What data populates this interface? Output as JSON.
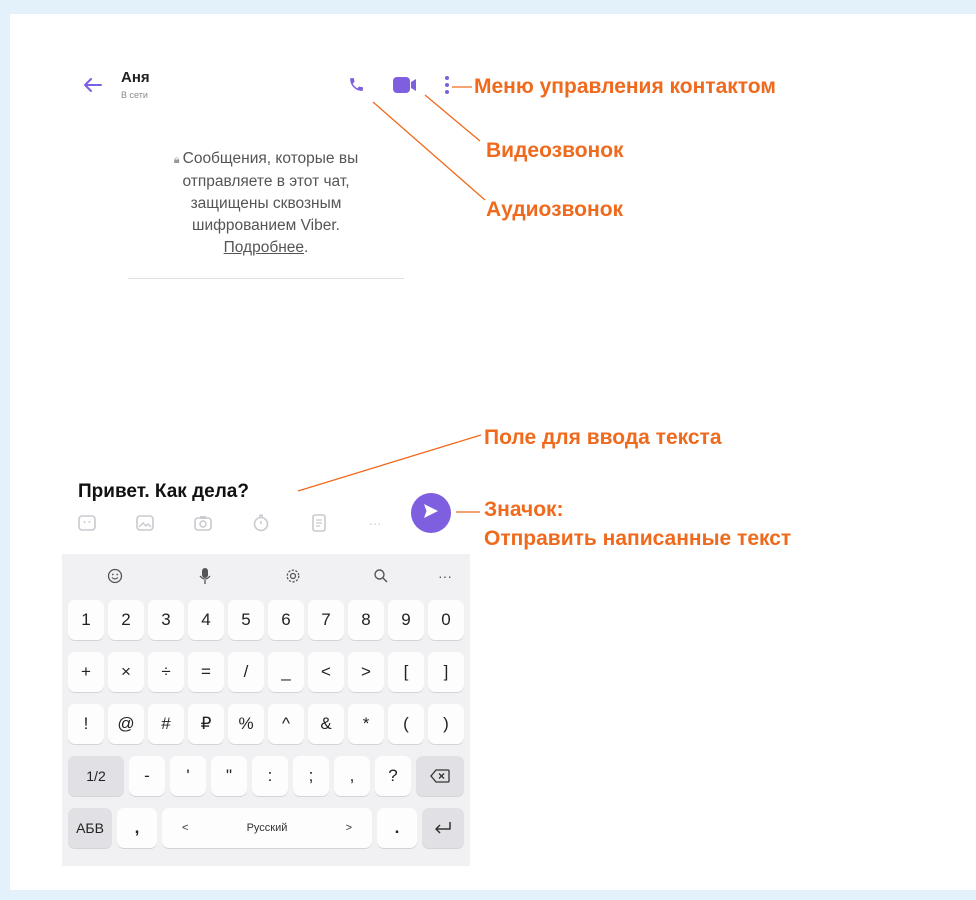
{
  "header": {
    "contact_name": "Аня",
    "contact_status": "В сети"
  },
  "icons": {
    "back": "arrow-left-icon",
    "audio_call": "phone-icon",
    "video_call": "video-camera-icon",
    "menu": "more-vertical-icon",
    "send": "send-icon"
  },
  "colors": {
    "accent": "#7d5fe0",
    "annotation": "#f06a1d"
  },
  "notice": {
    "line1": "Сообщения, которые вы",
    "line2": "отправляете в этот чат,",
    "line3": "защищены сквозным",
    "line4": "шифрованием Viber.",
    "link": "Подробнее",
    "link_suffix": "."
  },
  "annotations": {
    "menu": "Меню управления контактом",
    "video": "Видеозвонок",
    "audio": "Аудиозвонок",
    "input": "Поле для ввода текста",
    "send_line1": "Значок:",
    "send_line2": "Отправить написанные текст"
  },
  "input": {
    "value": "Привет. Как дела?"
  },
  "keyboard": {
    "toolbar": [
      "emoji-icon",
      "microphone-icon",
      "settings-icon",
      "search-icon",
      "more-icon"
    ],
    "toolbar_more": "···",
    "row1": [
      "1",
      "2",
      "3",
      "4",
      "5",
      "6",
      "7",
      "8",
      "9",
      "0"
    ],
    "row2": [
      "+",
      "×",
      "÷",
      "=",
      "/",
      "_",
      "<",
      ">",
      "[",
      "]"
    ],
    "row3": [
      "!",
      "@",
      "#",
      "₽",
      "%",
      "^",
      "&",
      "*",
      "(",
      ")"
    ],
    "row4": [
      "1/2",
      "-",
      "'",
      "\"",
      ":",
      ";",
      ",",
      "?"
    ],
    "row5": {
      "lang_switch": "АБВ",
      "comma": ",",
      "left": "<",
      "space": "Русский",
      "right": ">",
      "period": "."
    }
  }
}
